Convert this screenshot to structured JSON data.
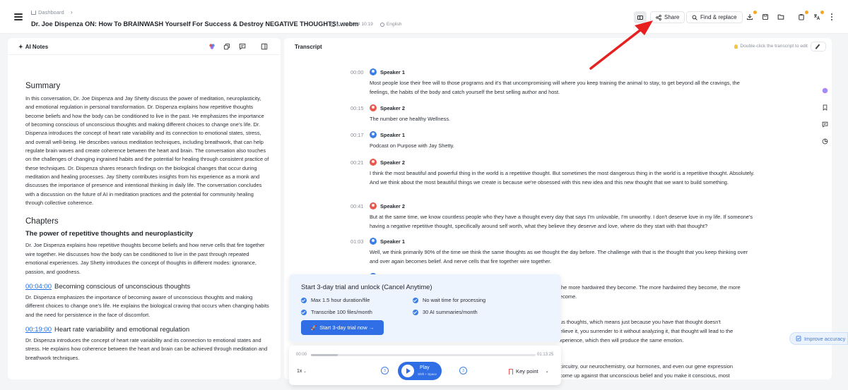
{
  "header": {
    "breadcrumb": "Dashboard",
    "title": "Dr. Joe Dispenza ON: How To BRAINWASH Yourself For Success & Destroy NEGATIVE THOUGHTS!.webm",
    "date": "11/26/2024 10:19",
    "language": "English",
    "share_label": "Share",
    "find_replace_label": "Find & replace",
    "badge_color": "#f5a623"
  },
  "notes": {
    "title": "AI Notes",
    "summary_heading": "Summary",
    "summary_text": "In this conversation, Dr. Joe Dispenza and Jay Shetty discuss the power of meditation, neuroplasticity, and emotional regulation in personal transformation. Dr. Dispenza explains how repetitive thoughts become beliefs and how the body can be conditioned to live in the past. He emphasizes the importance of becoming conscious of unconscious thoughts and making different choices to change one's life. Dr. Dispenza introduces the concept of heart rate variability and its connection to emotional states, stress, and overall well-being. He describes various meditation techniques, including breathwork, that can help regulate brain waves and create coherence between the heart and brain. The conversation also touches on the challenges of changing ingrained habits and the potential for healing through consistent practice of these techniques. Dr. Dispenza shares research findings on the biological changes that occur during meditation and healing processes. Jay Shetty contributes insights from his experience as a monk and discusses the importance of presence and intentional thinking in daily life. The conversation concludes with a discussion on the future of AI in meditation practices and the potential for community healing through collective coherence.",
    "chapters_heading": "Chapters",
    "chapters": [
      {
        "time": "",
        "title": "The power of repetitive thoughts and neuroplasticity",
        "text": "Dr. Joe Dispenza explains how repetitive thoughts become beliefs and how nerve cells that fire together wire together. He discusses how the body can be conditioned to live in the past through repeated emotional experiences. Jay Shetty introduces the concept of thoughts in different modes: ignorance, passion, and goodness."
      },
      {
        "time": "00:04:00",
        "title": "Becoming conscious of unconscious thoughts",
        "text": "Dr. Dispenza emphasizes the importance of becoming aware of unconscious thoughts and making different choices to change one's life. He explains the biological craving that occurs when changing habits and the need for persistence in the face of discomfort."
      },
      {
        "time": "00:19:00",
        "title": "Heart rate variability and emotional regulation",
        "text": "Dr. Dispenza introduces the concept of heart rate variability and its connection to emotional states and stress. He explains how coherence between the heart and brain can be achieved through meditation and breathwork techniques."
      }
    ]
  },
  "transcript": {
    "title": "Transcript",
    "edit_hint": "Double-click the transcript to edit",
    "improve_label": "Improve accuracy",
    "segments": [
      {
        "time": "00:00",
        "speaker": "Speaker 1",
        "text": "Most people lose their free will to those programs and it's that uncompromising will where you keep training the animal to stay, to get beyond all the cravings, the feelings, the habits of the body and catch yourself the best selling author and host.",
        "color": "#3d7fe6"
      },
      {
        "time": "00:15",
        "speaker": "Speaker 2",
        "text": "The number one healthy Wellness.",
        "color": "#e8584f"
      },
      {
        "time": "00:17",
        "speaker": "Speaker 1",
        "text": "Podcast on Purpose with Jay Shetty.",
        "color": "#3d7fe6"
      },
      {
        "time": "00:21",
        "speaker": "Speaker 2",
        "text": "I think the most beautiful and powerful thing in the world is a repetitive thought. But sometimes the most dangerous thing in the world is a repetitive thought. Absolutely. And we think about the most beautiful things we create is because we're obsessed with this new idea and this new thought that we want to build something.",
        "color": "#e8584f"
      },
      {
        "time": "00:41",
        "speaker": "Speaker 2",
        "text": "But at the same time, we know countless people who they have a thought every day that says I'm unlovable, I'm unworthy. I don't deserve love in my life. If someone's having a negative repetitive thought, specifically around self worth, what they believe they deserve and love, where do they start with that thought?",
        "color": "#e8584f"
      },
      {
        "time": "01:03",
        "speaker": "Speaker 1",
        "text": "Well, we think primarily 90% of the time we think the same thoughts as we thought the day before. The challenge with that is the thought that you keep thinking over and over again becomes belief. And nerve cells that fire together wire together.",
        "color": "#3d7fe6"
      }
    ],
    "partial_lines": [
      "the more hardwired they become. The more hardwired they become, the more",
      "ecome.",
      "us thoughts, which means just because you have that thought doesn't",
      "elieve it, you surrender to it without analyzing it, that thought will lead to the",
      "xperience, which then will produce the same emotion.",
      "circuitry, our neurochemistry, our hormones, and even our gene expression",
      "come up against that unconscious belief and you make it conscious, most"
    ]
  },
  "promo": {
    "title": "Start 3-day trial and unlock (Cancel Anytime)",
    "features": [
      "Max 1.5 hour duration/file",
      "No wait time for processing",
      "Transcribe 100 files/month",
      "30 AI summaries/month"
    ],
    "button_label": "Start 3-day trial now →"
  },
  "player": {
    "current_time": "00:00",
    "duration": "01:13:25",
    "progress": 0.12,
    "speed": "1x",
    "skip_back": "3",
    "skip_forward": "3",
    "play_label": "Play",
    "play_shortcut": "Shift + Space",
    "key_point_label": "Key point"
  }
}
